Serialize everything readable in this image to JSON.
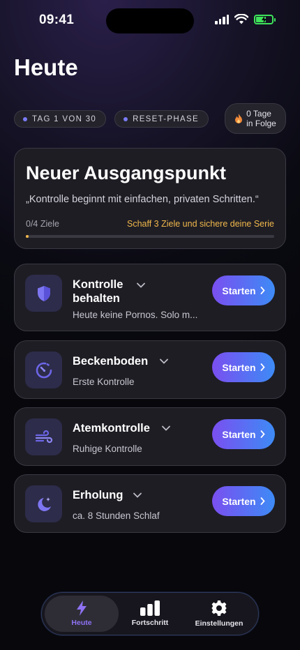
{
  "status_bar": {
    "time": "09:41"
  },
  "page": {
    "title": "Heute"
  },
  "chips": [
    {
      "label": "TAG 1 VON 30"
    },
    {
      "label": "RESET-PHASE"
    }
  ],
  "streak": {
    "line1": "0 Tage",
    "line2": "in Folge",
    "icon": "flame-icon"
  },
  "hero": {
    "title": "Neuer Ausgangspunkt",
    "quote": "„Kontrolle beginnt mit einfachen, privaten Schritten.“",
    "goals_count": "0/4 Ziele",
    "goals_hint": "Schaff 3 Ziele und sichere deine Serie",
    "progress": 0,
    "accent": "#f1b84b"
  },
  "tasks": [
    {
      "title": "Kontrolle behalten",
      "subtitle": "Heute keine Pornos. Solo m...",
      "button": "Starten",
      "icon": "shield-icon"
    },
    {
      "title": "Beckenboden",
      "subtitle": "Erste Kontrolle",
      "button": "Starten",
      "icon": "timer-icon"
    },
    {
      "title": "Atemkontrolle",
      "subtitle": "Ruhige Kontrolle",
      "button": "Starten",
      "icon": "wind-icon"
    },
    {
      "title": "Erholung",
      "subtitle": "ca. 8 Stunden Schlaf",
      "button": "Starten",
      "icon": "moon-icon"
    }
  ],
  "tabs": [
    {
      "label": "Heute",
      "icon": "bolt-icon",
      "active": true
    },
    {
      "label": "Fortschritt",
      "icon": "bar-chart-icon",
      "active": false
    },
    {
      "label": "Einstellungen",
      "icon": "gear-icon",
      "active": false
    }
  ],
  "colors": {
    "accent": "#7a7cf6",
    "active_tab": "#8f72f4",
    "button_start": "#7a4ff0",
    "button_end": "#3d8bf6",
    "battery": "#3ee35a"
  }
}
